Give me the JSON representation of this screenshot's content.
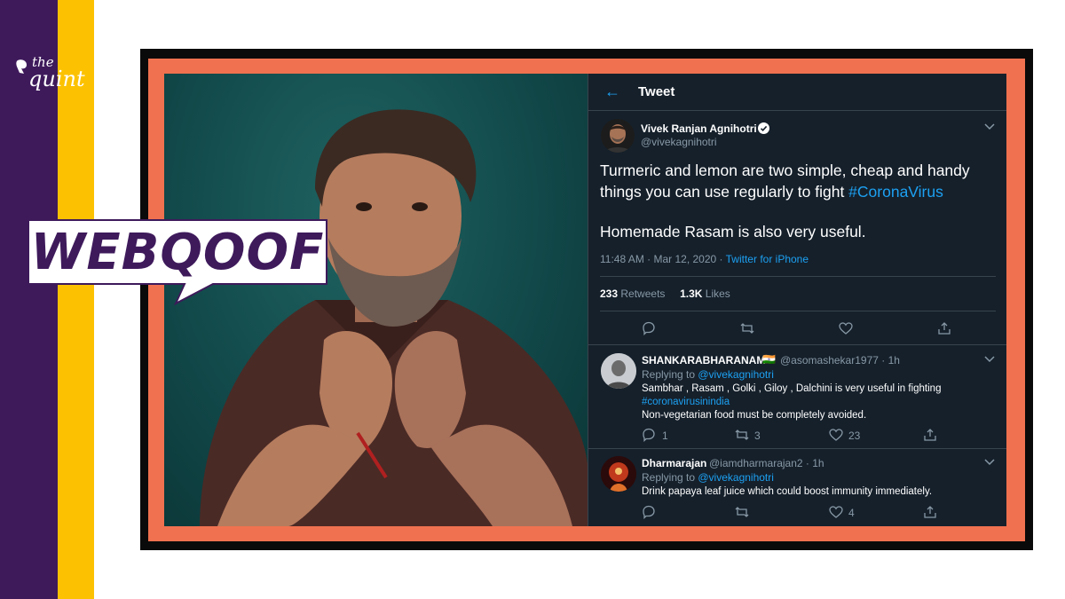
{
  "brand": {
    "logo_the": "the",
    "logo_quint": "quint",
    "colors": {
      "purple": "#3e1a5b",
      "yellow": "#fcc201",
      "frame": "#f0714f"
    }
  },
  "badge": {
    "text": "WEBQOOF"
  },
  "tweet": {
    "header": {
      "back_icon": "arrow-left-icon",
      "title": "Tweet"
    },
    "author": {
      "name": "Vivek Ranjan Agnihotri",
      "handle": "@vivekagnihotri",
      "verified": true
    },
    "body": {
      "line1_prefix": "Turmeric and lemon are two simple, cheap and handy things you can use regularly to fight ",
      "hashtag": "#CoronaVirus",
      "line2": "Homemade Rasam is also very useful."
    },
    "meta": {
      "time": "11:48 AM · Mar 12, 2020 · ",
      "source": "Twitter for iPhone"
    },
    "stats": {
      "retweets": "233",
      "retweets_label": "Retweets",
      "likes": "1.3K",
      "likes_label": "Likes"
    },
    "replies": [
      {
        "name": "SHANKARABHARANAM",
        "flag": "🇮🇳",
        "handle": "@asomashekar1977 · 1h",
        "replying_prefix": "Replying to ",
        "replying_to": "@vivekagnihotri",
        "text1": "Sambhar , Rasam , Golki , Giloy , Dalchini is very useful in fighting",
        "hashtag": "#coronavirusinindia",
        "text2": "Non-vegetarian food must be completely avoided.",
        "replies_count": "1",
        "retweets_count": "3",
        "likes_count": "23"
      },
      {
        "name": "Dharmarajan",
        "handle": "@iamdharmarajan2 · 1h",
        "replying_prefix": "Replying to ",
        "replying_to": "@vivekagnihotri",
        "text1": "Drink papaya leaf juice which could boost immunity immediately.",
        "replies_count": "",
        "retweets_count": "",
        "likes_count": "4"
      }
    ]
  }
}
